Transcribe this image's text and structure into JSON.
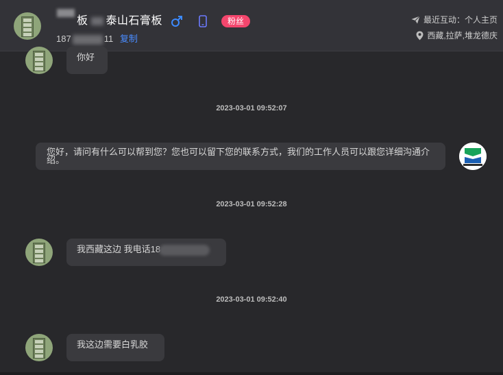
{
  "header": {
    "contact_name": "板",
    "contact_company": "泰山石膏板",
    "fan_badge": "粉丝",
    "phone_prefix": "187",
    "phone_suffix": "11",
    "copy_label": "复制",
    "recent_interaction": "最近互动：个人主页",
    "location": "西藏,拉萨,堆龙德庆"
  },
  "messages": [
    {
      "text": "你好"
    },
    {
      "timestamp": "2023-03-01 09:52:07"
    },
    {
      "text": "您好，请问有什么可以帮到您？您也可以留下您的联系方式，我们的工作人员可以跟您详细沟通介绍。"
    },
    {
      "timestamp": "2023-03-01 09:52:28"
    },
    {
      "text": "我西藏这边 我电话18"
    },
    {
      "timestamp": "2023-03-01 09:52:40"
    },
    {
      "text": "我这边需要白乳胶"
    }
  ],
  "colors": {
    "accent_link": "#4a8cff",
    "fan_badge_bg": "#f4466d",
    "male_icon": "#3d8bff",
    "phone_icon": "#6c7bff"
  },
  "icons": {
    "male": "male-icon",
    "phone": "phone-icon",
    "send": "send-icon",
    "location": "location-pin-icon"
  }
}
